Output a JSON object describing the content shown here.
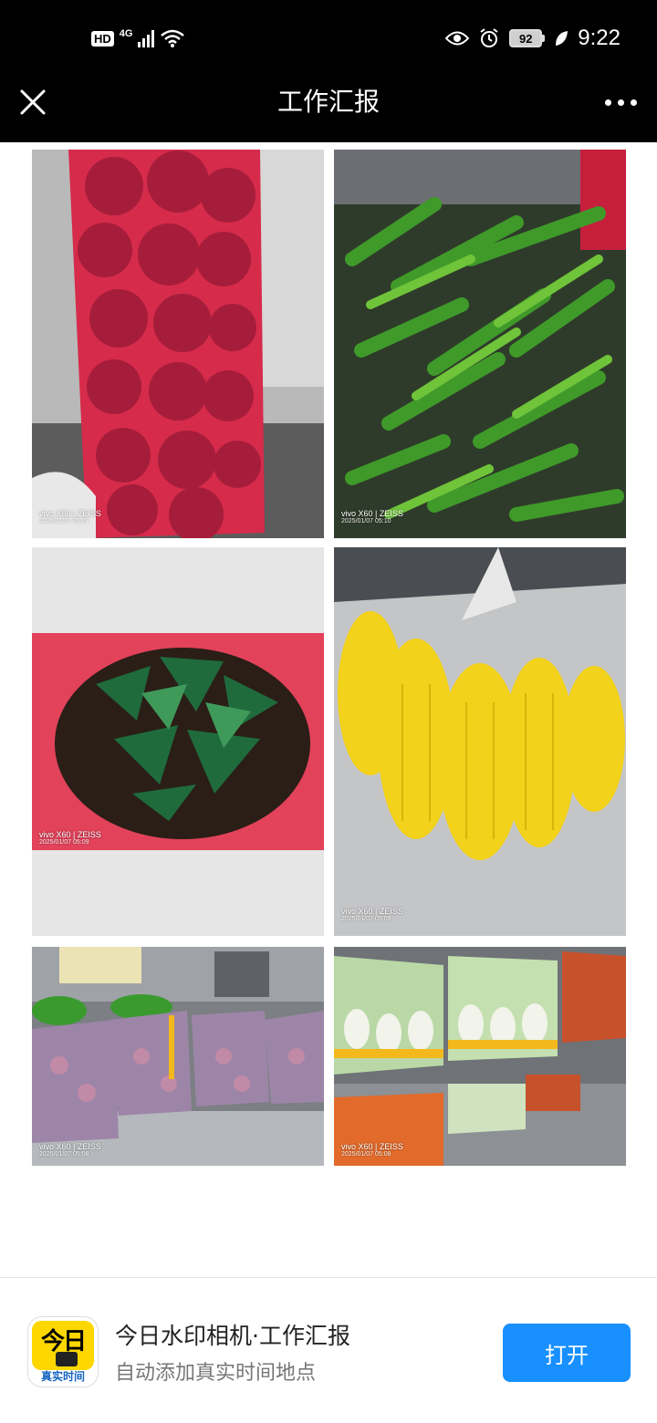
{
  "status_bar": {
    "hd": "HD",
    "network": "4G",
    "battery": "92",
    "time": "9:22"
  },
  "top_bar": {
    "title": "工作汇报"
  },
  "photos": [
    {
      "name": "onions",
      "watermark_model": "vivo X60 | ZEISS",
      "watermark_date": "2025/01/07 05:07"
    },
    {
      "name": "green-peppers",
      "watermark_model": "vivo X60 | ZEISS",
      "watermark_date": "2025/01/07 05:10"
    },
    {
      "name": "kelp",
      "watermark_model": "vivo X60 | ZEISS",
      "watermark_date": "2025/01/07 05:09"
    },
    {
      "name": "corn",
      "watermark_model": "vivo X60 | ZEISS",
      "watermark_date": "2025/01/07 05:09"
    },
    {
      "name": "radishes",
      "watermark_model": "vivo X60 | ZEISS",
      "watermark_date": "2025/01/07 05:08"
    },
    {
      "name": "cabbages",
      "watermark_model": "vivo X60 | ZEISS",
      "watermark_date": "2025/01/07 05:08"
    }
  ],
  "footer": {
    "app_icon_top": "今日",
    "app_icon_bottom": "真实时间",
    "app_name": "今日水印相机·工作汇报",
    "app_desc": "自动添加真实时间地点",
    "open_label": "打开"
  },
  "colors": {
    "bar_bg": "#000000",
    "open_button": "#1890ff",
    "app_icon_yellow": "#ffd700"
  }
}
